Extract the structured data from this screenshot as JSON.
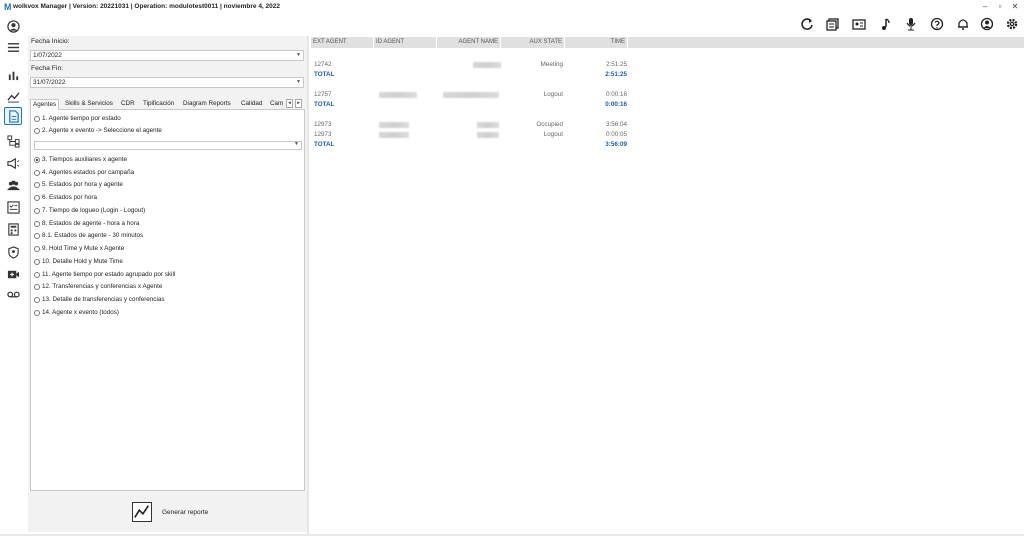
{
  "app": {
    "logo": "M",
    "title": "wolkvox Manager  | Version: 20221031 |  Operation: modulotest0011 | noviembre 4, 2022",
    "window_controls": [
      "–",
      "▫",
      "✕"
    ]
  },
  "toolbar": {
    "icons": [
      "refresh-icon",
      "copy-report-icon",
      "contact-card-icon",
      "music-note-icon",
      "microphone-icon",
      "help-icon",
      "bell-icon",
      "user-profile-icon",
      "settings-icon"
    ]
  },
  "nav": {
    "icons": [
      "user-icon",
      "menu-icon",
      "bar-chart-icon",
      "analytics-icon",
      "report-icon",
      "hierarchy-icon",
      "campaign-icon",
      "users-group-icon",
      "checklist-icon",
      "calculator-icon",
      "shield-user-icon",
      "video-add-icon",
      "voicemail-icon"
    ]
  },
  "filters": {
    "start_label": "Fecha Inicio:",
    "start_value": "1/07/2022",
    "end_label": "Fecha Fin:",
    "end_value": "31/07/2022"
  },
  "tabs": [
    "Agentes",
    "Skills & Servicios",
    "CDR",
    "Tipificación",
    "Diagram Reports",
    "Calidad",
    "Cam"
  ],
  "tab_scroll": [
    "◂",
    "▸"
  ],
  "options": [
    {
      "label": "1. Agente tiempo por estado",
      "selected": false
    },
    {
      "label": "2. Agente x evento -> Seleccione el agente",
      "selected": false
    },
    {
      "label": "3. Tiempos auxiliares x agente",
      "selected": true
    },
    {
      "label": "4. Agentes estados por campaña",
      "selected": false
    },
    {
      "label": "5. Estados por hora y agente",
      "selected": false
    },
    {
      "label": "6. Estados por hora",
      "selected": false
    },
    {
      "label": "7. Tiempo de logueo (Login - Logout)",
      "selected": false
    },
    {
      "label": "8. Estados de agente - hora a hora",
      "selected": false
    },
    {
      "label": "8.1. Estados de agente - 30 minutos",
      "selected": false
    },
    {
      "label": "9. Hold Time y Mute x Agente",
      "selected": false
    },
    {
      "label": "10. Detalle Hold y Mute Time",
      "selected": false
    },
    {
      "label": "11. Agente tiempo por estado agrupado por skill",
      "selected": false
    },
    {
      "label": "12. Transferencias y conferencias x Agente",
      "selected": false
    },
    {
      "label": "13. Detalle de transferencias y conferencias",
      "selected": false
    },
    {
      "label": "14. Agente x evento (todos)",
      "selected": false
    }
  ],
  "generate_label": "Generar reporte",
  "grid": {
    "columns": [
      "EXT AGENT",
      "ID AGENT",
      "AGENT NAME",
      "AUX STATE",
      "TIME"
    ],
    "rows": [
      {
        "ext": "12742",
        "state": "Meeting",
        "time": "2:51:25",
        "total": false
      },
      {
        "ext": "TOTAL",
        "state": "",
        "time": "2:51:25",
        "total": true
      },
      {
        "ext": "12757",
        "state": "Logout",
        "time": "0:00:16",
        "total": false
      },
      {
        "ext": "TOTAL",
        "state": "",
        "time": "0:00:16",
        "total": true
      },
      {
        "ext": "12973",
        "state": "Occupied",
        "time": "3:56:04",
        "total": false
      },
      {
        "ext": "12973",
        "state": "Logout",
        "time": "0:00:05",
        "total": false
      },
      {
        "ext": "TOTAL",
        "state": "",
        "time": "3:56:09",
        "total": true
      }
    ]
  }
}
